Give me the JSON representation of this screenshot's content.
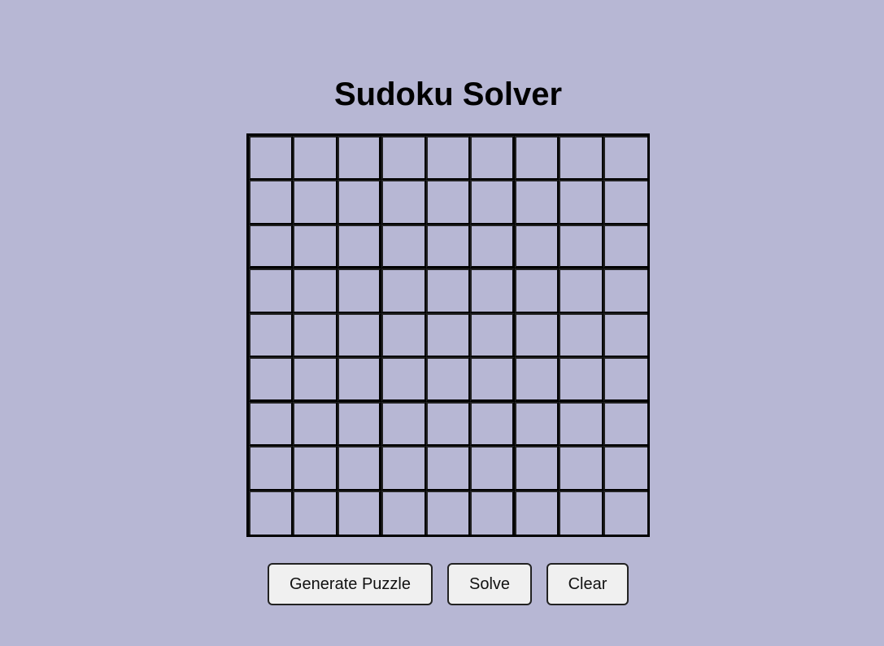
{
  "title": "Sudoku Solver",
  "grid": {
    "rows": 9,
    "cols": 9,
    "cells": [
      [
        "",
        "",
        "",
        "",
        "",
        "",
        "",
        "",
        ""
      ],
      [
        "",
        "",
        "",
        "",
        "",
        "",
        "",
        "",
        ""
      ],
      [
        "",
        "",
        "",
        "",
        "",
        "",
        "",
        "",
        ""
      ],
      [
        "",
        "",
        "",
        "",
        "",
        "",
        "",
        "",
        ""
      ],
      [
        "",
        "",
        "",
        "",
        "",
        "",
        "",
        "",
        ""
      ],
      [
        "",
        "",
        "",
        "",
        "",
        "",
        "",
        "",
        ""
      ],
      [
        "",
        "",
        "",
        "",
        "",
        "",
        "",
        "",
        ""
      ],
      [
        "",
        "",
        "",
        "",
        "",
        "",
        "",
        "",
        ""
      ],
      [
        "",
        "",
        "",
        "",
        "",
        "",
        "",
        "",
        ""
      ]
    ]
  },
  "buttons": {
    "generate_label": "Generate Puzzle",
    "solve_label": "Solve",
    "clear_label": "Clear"
  },
  "colors": {
    "background": "#b7b7d4",
    "grid_lines": "#000000",
    "button_bg": "#f0f0f0"
  }
}
